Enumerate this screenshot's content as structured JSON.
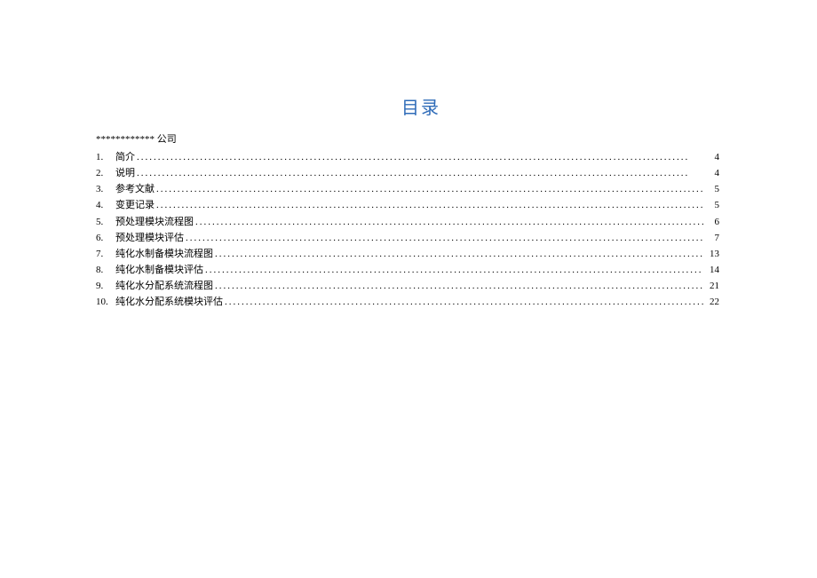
{
  "title": "目录",
  "company": "************ 公司",
  "entries": [
    {
      "num": "1.",
      "text": "简介",
      "page": "4"
    },
    {
      "num": "2.",
      "text": "说明",
      "page": "4"
    },
    {
      "num": "3.",
      "text": "参考文献",
      "page": "5"
    },
    {
      "num": "4.",
      "text": "变更记录",
      "page": "5"
    },
    {
      "num": "5.",
      "text": "预处理模块流程图",
      "page": "6"
    },
    {
      "num": "6.",
      "text": "预处理模块评估",
      "page": "7"
    },
    {
      "num": "7.",
      "text": "纯化水制备模块流程图",
      "page": "13"
    },
    {
      "num": "8.",
      "text": "纯化水制备模块评估",
      "page": "14"
    },
    {
      "num": "9.",
      "text": "纯化水分配系统流程图",
      "page": "21"
    },
    {
      "num": "10.",
      "text": "纯化水分配系统模块评估",
      "page": "22"
    }
  ]
}
